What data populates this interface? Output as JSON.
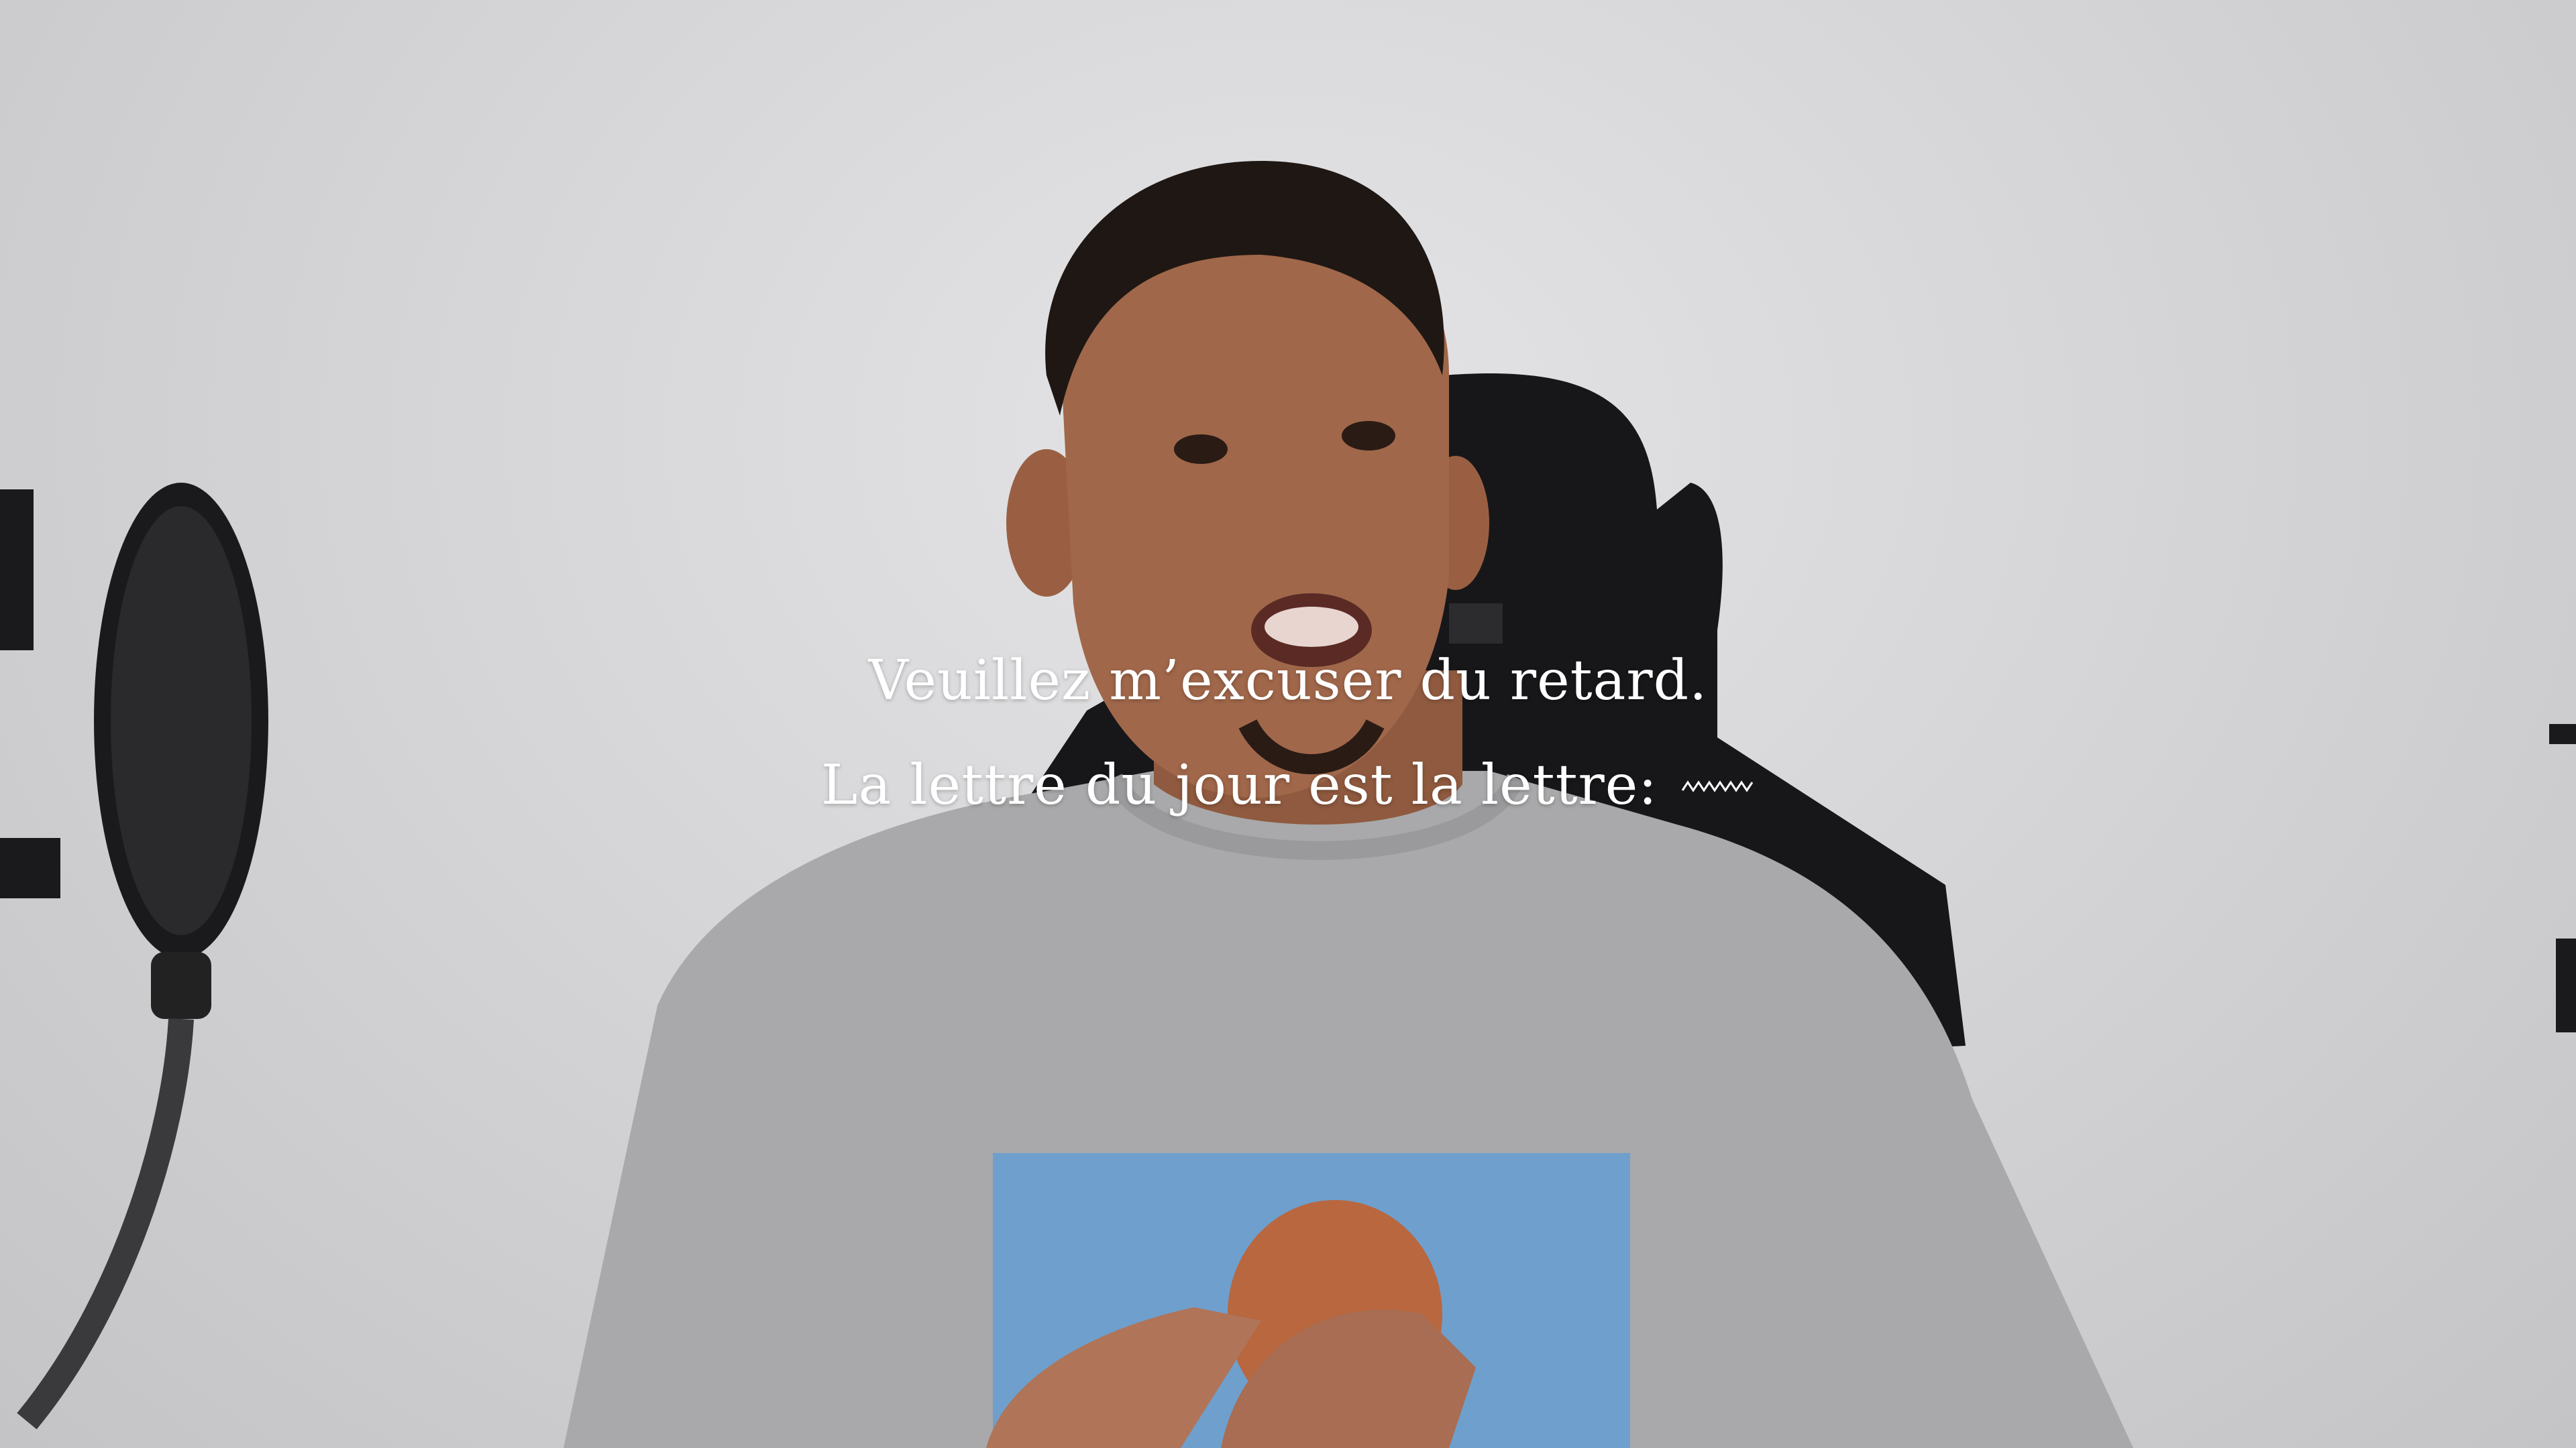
{
  "subtitles": {
    "line1": "Veuillez m’excuser du retard.",
    "line2": "La lettre du jour est la lettre:"
  },
  "colors": {
    "wall": "#d6d6d8",
    "subtitle_text": "#ffffff",
    "sweater": "#a9a9ab",
    "print_blue": "#6f9fcd",
    "skin": "#a0674a",
    "chair": "#1b1b1d"
  }
}
